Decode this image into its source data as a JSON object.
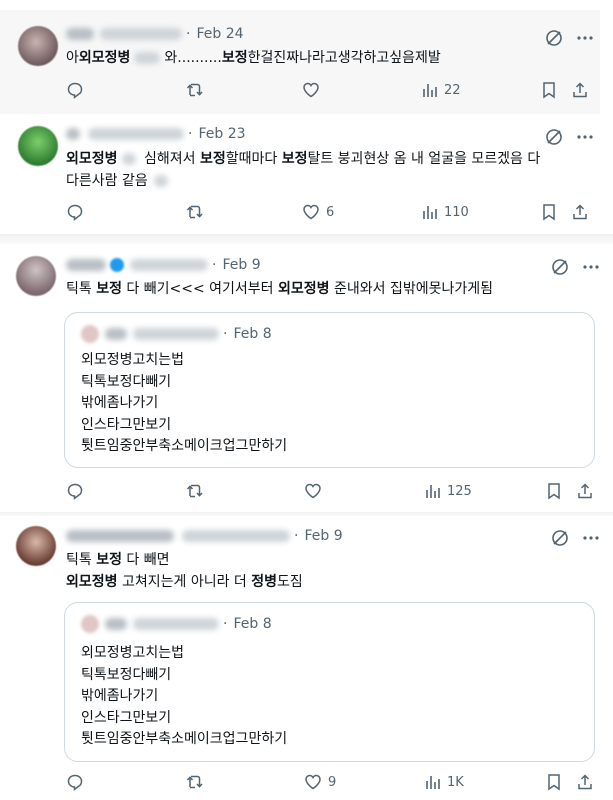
{
  "colors": {
    "muted": "#536471",
    "border": "#cfd9de",
    "text": "#0f1419",
    "blue": "#1d9bf0"
  },
  "posts": [
    {
      "date": "Feb 24",
      "text_parts": [
        {
          "t": "아",
          "b": false
        },
        {
          "t": "외모정병",
          "b": true
        },
        {
          "t": "blur",
          "b": false
        },
        {
          "t": "와..........",
          "b": false
        },
        {
          "t": "보정",
          "b": true
        },
        {
          "t": "한걸진짜나라고생각하고싶음제발",
          "b": false
        }
      ],
      "stats": {
        "reply": "",
        "retweet": "",
        "like": "",
        "views": "22"
      }
    },
    {
      "date": "Feb 23",
      "line1_parts": [
        {
          "t": "외모정병",
          "b": true
        },
        {
          "t": "blur",
          "b": false
        },
        {
          "t": " 심해져서 ",
          "b": false
        },
        {
          "t": "보정",
          "b": true
        },
        {
          "t": "할때마다 ",
          "b": false
        },
        {
          "t": "보정",
          "b": true
        },
        {
          "t": "탈트 붕괴현상 옴 내 얼굴을 모르겠음 다",
          "b": false
        }
      ],
      "line2": "다른사람 같음",
      "stats": {
        "reply": "",
        "retweet": "",
        "like": "6",
        "views": "110"
      }
    },
    {
      "date": "Feb 9",
      "line1_parts": [
        {
          "t": "틱톡 ",
          "b": false
        },
        {
          "t": "보정",
          "b": true
        },
        {
          "t": " 다 빼기<<< 여기서부터 ",
          "b": false
        },
        {
          "t": "외모정병",
          "b": true
        },
        {
          "t": " 준내와서 집밖에못나가게됨",
          "b": false
        }
      ],
      "quote": {
        "date": "Feb 8",
        "lines": [
          "외모정병고치는법",
          "틱톡보정다빼기",
          "밖에좀나가기",
          "인스타그만보기",
          "튓트임중안부축소메이크업그만하기"
        ]
      },
      "stats": {
        "reply": "",
        "retweet": "",
        "like": "",
        "views": "125"
      }
    },
    {
      "date": "Feb 9",
      "line1_parts": [
        {
          "t": "틱톡 ",
          "b": false
        },
        {
          "t": "보정",
          "b": true
        },
        {
          "t": " 다 빼면",
          "b": false
        }
      ],
      "line2_parts": [
        {
          "t": "외모정병",
          "b": true
        },
        {
          "t": " 고쳐지는게 아니라 더 ",
          "b": false
        },
        {
          "t": "정병",
          "b": true
        },
        {
          "t": "도짐",
          "b": false
        }
      ],
      "quote": {
        "date": "Feb 8",
        "lines": [
          "외모정병고치는법",
          "틱톡보정다빼기",
          "밖에좀나가기",
          "인스타그만보기",
          "튓트임중안부축소메이크업그만하기"
        ]
      },
      "stats": {
        "reply": "",
        "retweet": "",
        "like": "9",
        "views": "1K"
      }
    }
  ]
}
